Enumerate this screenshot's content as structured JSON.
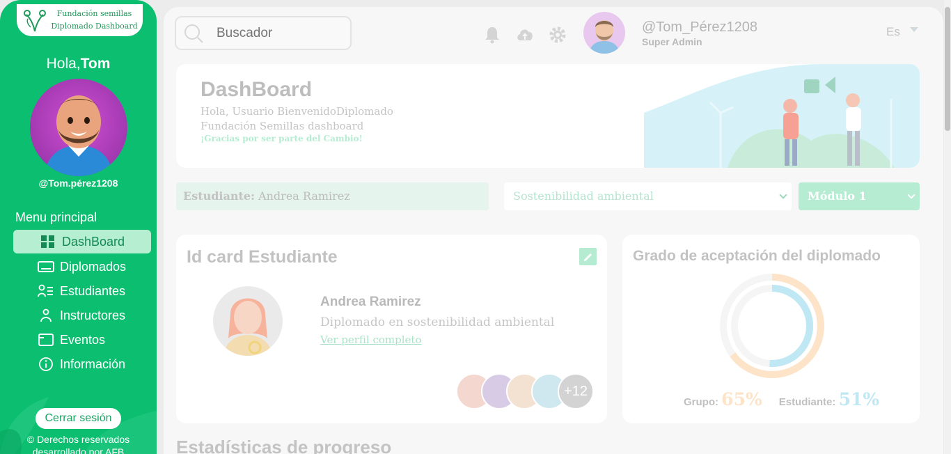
{
  "sidebar": {
    "logo_line1": "Fundación semillas",
    "logo_line2": "Diplomado Dashboard",
    "greeting_prefix": "Hola,",
    "greeting_name": "Tom",
    "handle": "@Tom.pérez1208",
    "menu_title": "Menu principal",
    "items": [
      {
        "label": "DashBoard",
        "icon": "grid-icon"
      },
      {
        "label": "Diplomados",
        "icon": "keyboard-icon"
      },
      {
        "label": "Estudiantes",
        "icon": "user-list-icon"
      },
      {
        "label": "Instructores",
        "icon": "user-icon"
      },
      {
        "label": "Eventos",
        "icon": "window-icon"
      },
      {
        "label": "Información",
        "icon": "info-icon"
      }
    ],
    "logout_label": "Cerrar sesión",
    "rights_line1": "© Derechos reservados",
    "rights_line2": "desarrollado por AFB"
  },
  "header": {
    "search_placeholder": "Buscador",
    "user": "@Tom_Pérez1208",
    "role": "Super Admin",
    "language": "Es"
  },
  "hero": {
    "title": "DashBoard",
    "subtitle": "Hola, Usuario BienvenidoDiplomado Fundación Semillas dashboard",
    "note": "¡Gracias por ser parte del Cambio!"
  },
  "filters": {
    "student_label": "Estudiante:",
    "student_value": "Andrea Ramirez",
    "course": "Sostenibilidad ambiental",
    "module": "Módulo 1"
  },
  "id_card": {
    "title": "Id card Estudiante",
    "name": "Andrea Ramirez",
    "course": "Diplomado en sostenibilidad ambiental",
    "link": "Ver perfil completo",
    "more_count": "+12"
  },
  "acceptance": {
    "title": "Grado de aceptación del diplomado",
    "group_label": "Grupo:",
    "group_value": "65%",
    "student_label": "Estudiante:",
    "student_value": "51%",
    "colors": {
      "group": "#fde3c7",
      "student": "#bfe7f4"
    }
  },
  "progress": {
    "title": "Estadísticas de progreso"
  }
}
